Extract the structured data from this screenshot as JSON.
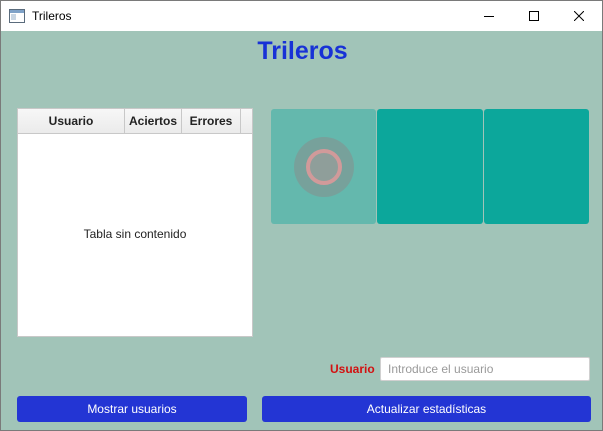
{
  "window": {
    "title": "Trileros",
    "icon": "app-window-icon"
  },
  "heading": "Trileros",
  "table": {
    "columns": [
      "Usuario",
      "Aciertos",
      "Errores"
    ],
    "rows": [],
    "empty_text": "Tabla sin contenido"
  },
  "cups": {
    "count": 3,
    "revealed_index": 0,
    "colors": {
      "revealed": "#64b8ad",
      "hidden": "#0ca79b",
      "ball_outer": "#7d9a96",
      "ball_ring": "#d19a9a"
    }
  },
  "user": {
    "label": "Usuario",
    "value": "",
    "placeholder": "Introduce el usuario"
  },
  "buttons": {
    "show_users": "Mostrar usuarios",
    "update_stats": "Actualizar estadísticas"
  },
  "colors": {
    "background": "#a1c4b8",
    "heading": "#1832d6",
    "button": "#2335d4",
    "user_label": "#d21010"
  }
}
